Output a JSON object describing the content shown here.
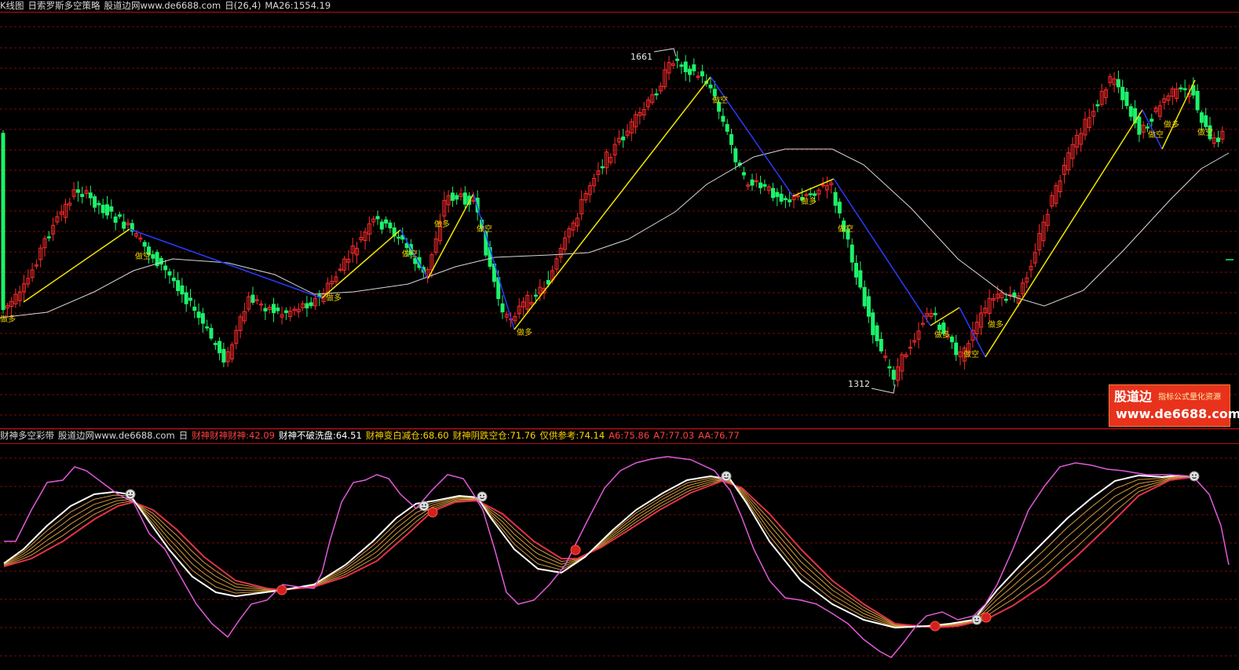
{
  "colors": {
    "background": "#000000",
    "grid": "#7a0a0a",
    "separator": "#b51010",
    "bull_candle": "#ff2b2b",
    "bear_candle": "#1cf26b",
    "ma_line": "#d8d8d8",
    "zigzag_up": "#f2e600",
    "zigzag_down": "#2a3bff",
    "signal_text": "#f2d400",
    "band_outer": "#e05ad8",
    "band_white": "#ffffff",
    "band_red": "#e0324a",
    "band_inner": "#d49a3a",
    "header_text": "#d8d8d8",
    "header_red": "#ff4040",
    "header_yellow": "#ffd200"
  },
  "top_header": {
    "panel_name": "K线图",
    "indicator_name": "日索罗斯多空策略",
    "site": "股道边网www.de6688.com",
    "period_params": "日(26,4)",
    "ma_label": "MA26:1554.19"
  },
  "bottom_header": {
    "indicator_name": "财神多空彩带",
    "site": "股道边网www.de6688.com",
    "period": "日",
    "values": [
      {
        "label": "财神财神财神:42.09",
        "color": "#ff4040"
      },
      {
        "label": "财神不破洗盘:64.51",
        "color": "#ffffff"
      },
      {
        "label": "财神变白减仓:68.60",
        "color": "#ffd200"
      },
      {
        "label": "财神阴跌空仓:71.76",
        "color": "#ffd200"
      },
      {
        "label": "仅供参考:74.14",
        "color": "#ffd200"
      },
      {
        "label": "A6:75.86",
        "color": "#ff4040"
      },
      {
        "label": "A7:77.03",
        "color": "#ff4040"
      },
      {
        "label": "AA:76.77",
        "color": "#ff4040"
      }
    ]
  },
  "price_annotations": {
    "high": "1661",
    "low": "1312"
  },
  "signals": {
    "buy": "做多",
    "sell": "做空"
  },
  "logo": {
    "name": "股道边",
    "slogan": "指标公式量化资源",
    "url": "www.de6688.com"
  }
}
